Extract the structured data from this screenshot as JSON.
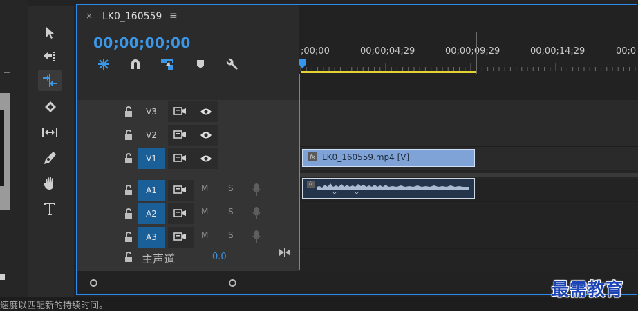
{
  "sequence": {
    "tab_title": "LK0_160559",
    "close_glyph": "×",
    "menu_glyph": "≡",
    "timecode": "00;00;00;00"
  },
  "ruler": {
    "labels": [
      ";00;00",
      "00;00;04;29",
      "00;00;09;29",
      "00;00;14;29",
      "00;0"
    ]
  },
  "tracks": {
    "video": [
      {
        "name": "V3",
        "targeted": false
      },
      {
        "name": "V2",
        "targeted": false
      },
      {
        "name": "V1",
        "targeted": true
      }
    ],
    "audio": [
      {
        "name": "A1",
        "mute": "M",
        "solo": "S"
      },
      {
        "name": "A2",
        "mute": "M",
        "solo": "S"
      },
      {
        "name": "A3",
        "mute": "M",
        "solo": "S"
      }
    ],
    "master": {
      "label": "主声道",
      "value": "0.0"
    }
  },
  "clips": {
    "video_label": "LK0_160559.mp4 [V]",
    "fx_badge": "fx"
  },
  "status": {
    "text": "速度以匹配新的持续时间。"
  },
  "watermark": "最需教育",
  "colors": {
    "accent": "#3b98e8",
    "workarea": "#e3d22f",
    "target": "#1b5f98",
    "video_clip": "#7fa3d6",
    "audio_clip": "#24344b"
  }
}
